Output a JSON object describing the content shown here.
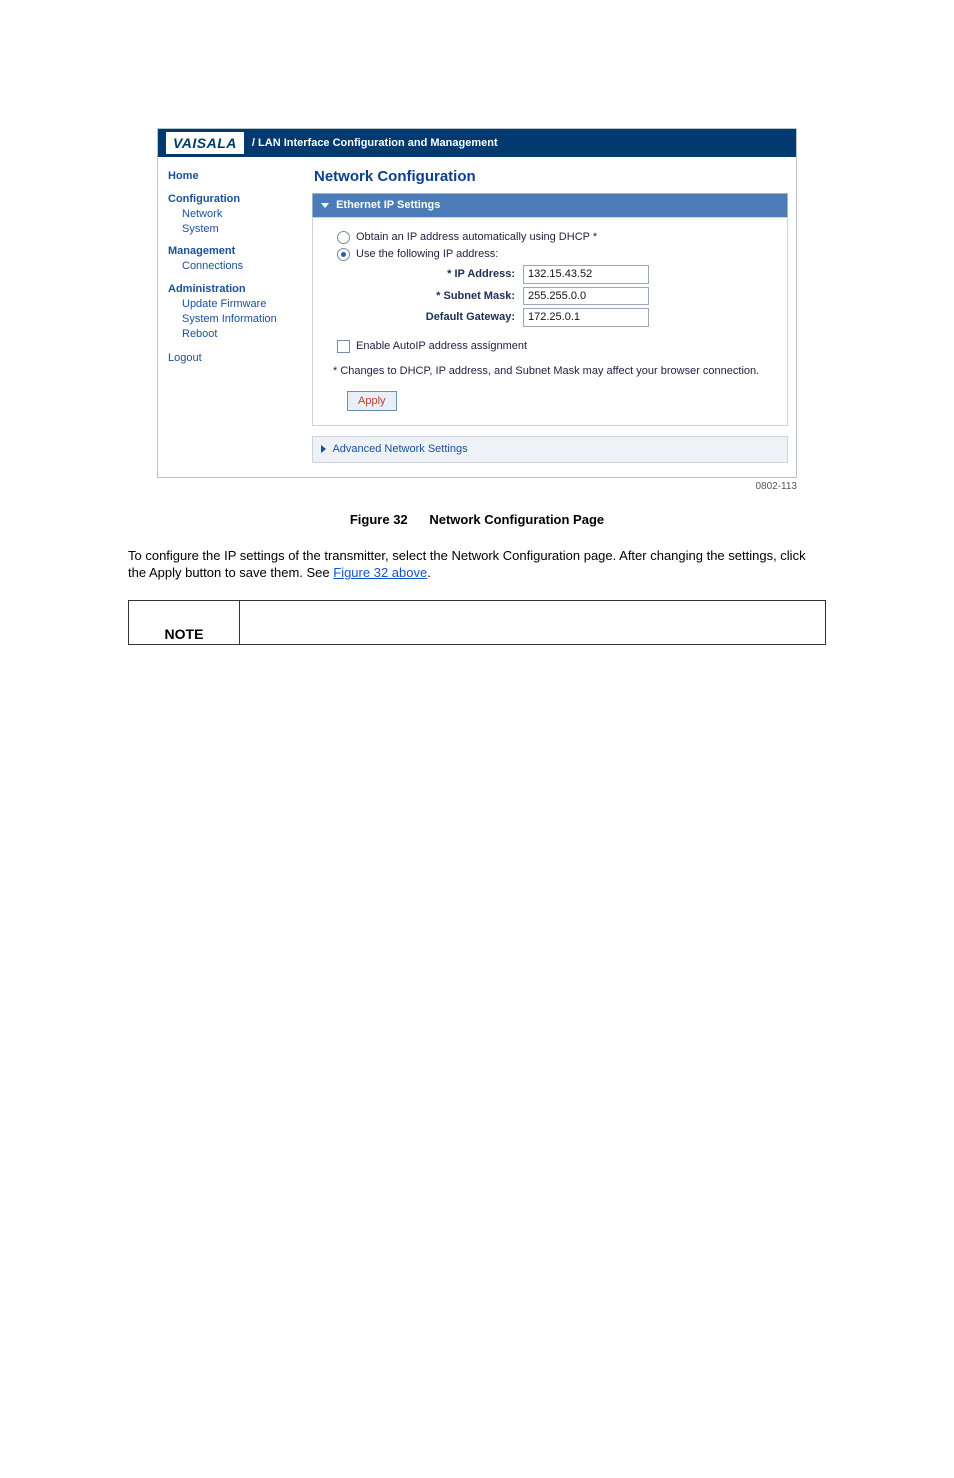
{
  "header": {
    "logo": "VAISALA",
    "title": "/ LAN Interface Configuration and Management"
  },
  "sidebar": {
    "items": [
      {
        "label": "Home",
        "bold": false,
        "indent": 0,
        "top": true
      },
      {
        "label": "Configuration",
        "bold": true,
        "indent": 0
      },
      {
        "label": "Network",
        "bold": false,
        "indent": 1
      },
      {
        "label": "System",
        "bold": false,
        "indent": 1
      },
      {
        "label": "Management",
        "bold": true,
        "indent": 0
      },
      {
        "label": "Connections",
        "bold": false,
        "indent": 1
      },
      {
        "label": "Administration",
        "bold": true,
        "indent": 0
      },
      {
        "label": "Update Firmware",
        "bold": false,
        "indent": 1
      },
      {
        "label": "System Information",
        "bold": false,
        "indent": 1
      },
      {
        "label": "Reboot",
        "bold": false,
        "indent": 1
      },
      {
        "label": "Logout",
        "bold": false,
        "indent": 0,
        "gap": true
      }
    ]
  },
  "main": {
    "page_title": "Network Configuration",
    "panel_title": "Ethernet IP Settings",
    "radio_dhcp": "Obtain an IP address automatically using DHCP *",
    "radio_static": "Use the following IP address:",
    "fields": {
      "ip_label": "* IP Address:",
      "ip_value": "132.15.43.52",
      "mask_label": "* Subnet Mask:",
      "mask_value": "255.255.0.0",
      "gw_label": "Default Gateway:",
      "gw_value": "172.25.0.1"
    },
    "autoip": "Enable AutoIP address assignment",
    "warn": "* Changes to DHCP, IP address, and Subnet Mask may affect your browser connection.",
    "apply": "Apply",
    "adv": "Advanced Network Settings"
  },
  "figref": "0802-113",
  "caption_num": "Figure 32",
  "caption_txt": "Network Configuration Page",
  "body_para": "To configure the IP settings of the transmitter, select the Network Configuration page. After changing the settings, click the Apply button to save them. See ",
  "xref": "Figure 32 above",
  "note": {
    "label": "NOTE"
  }
}
